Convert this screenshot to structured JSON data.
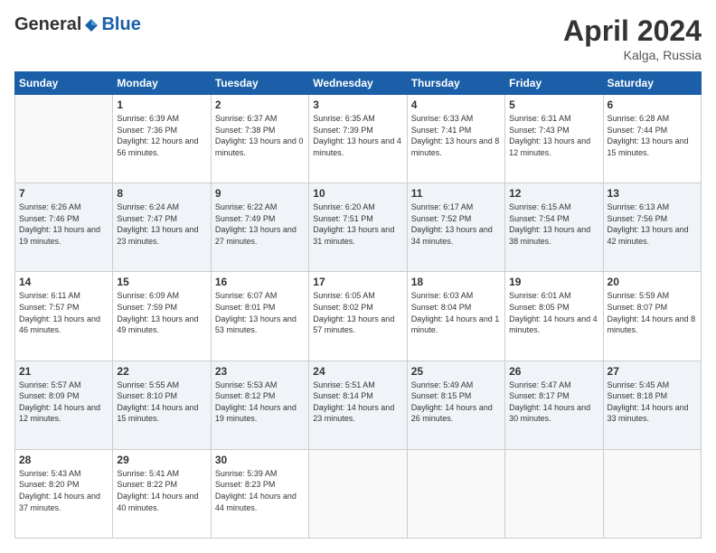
{
  "header": {
    "logo_general": "General",
    "logo_blue": "Blue",
    "month_title": "April 2024",
    "location": "Kalga, Russia"
  },
  "days_of_week": [
    "Sunday",
    "Monday",
    "Tuesday",
    "Wednesday",
    "Thursday",
    "Friday",
    "Saturday"
  ],
  "weeks": [
    [
      {
        "day": "",
        "sunrise": "",
        "sunset": "",
        "daylight": ""
      },
      {
        "day": "1",
        "sunrise": "Sunrise: 6:39 AM",
        "sunset": "Sunset: 7:36 PM",
        "daylight": "Daylight: 12 hours and 56 minutes."
      },
      {
        "day": "2",
        "sunrise": "Sunrise: 6:37 AM",
        "sunset": "Sunset: 7:38 PM",
        "daylight": "Daylight: 13 hours and 0 minutes."
      },
      {
        "day": "3",
        "sunrise": "Sunrise: 6:35 AM",
        "sunset": "Sunset: 7:39 PM",
        "daylight": "Daylight: 13 hours and 4 minutes."
      },
      {
        "day": "4",
        "sunrise": "Sunrise: 6:33 AM",
        "sunset": "Sunset: 7:41 PM",
        "daylight": "Daylight: 13 hours and 8 minutes."
      },
      {
        "day": "5",
        "sunrise": "Sunrise: 6:31 AM",
        "sunset": "Sunset: 7:43 PM",
        "daylight": "Daylight: 13 hours and 12 minutes."
      },
      {
        "day": "6",
        "sunrise": "Sunrise: 6:28 AM",
        "sunset": "Sunset: 7:44 PM",
        "daylight": "Daylight: 13 hours and 15 minutes."
      }
    ],
    [
      {
        "day": "7",
        "sunrise": "Sunrise: 6:26 AM",
        "sunset": "Sunset: 7:46 PM",
        "daylight": "Daylight: 13 hours and 19 minutes."
      },
      {
        "day": "8",
        "sunrise": "Sunrise: 6:24 AM",
        "sunset": "Sunset: 7:47 PM",
        "daylight": "Daylight: 13 hours and 23 minutes."
      },
      {
        "day": "9",
        "sunrise": "Sunrise: 6:22 AM",
        "sunset": "Sunset: 7:49 PM",
        "daylight": "Daylight: 13 hours and 27 minutes."
      },
      {
        "day": "10",
        "sunrise": "Sunrise: 6:20 AM",
        "sunset": "Sunset: 7:51 PM",
        "daylight": "Daylight: 13 hours and 31 minutes."
      },
      {
        "day": "11",
        "sunrise": "Sunrise: 6:17 AM",
        "sunset": "Sunset: 7:52 PM",
        "daylight": "Daylight: 13 hours and 34 minutes."
      },
      {
        "day": "12",
        "sunrise": "Sunrise: 6:15 AM",
        "sunset": "Sunset: 7:54 PM",
        "daylight": "Daylight: 13 hours and 38 minutes."
      },
      {
        "day": "13",
        "sunrise": "Sunrise: 6:13 AM",
        "sunset": "Sunset: 7:56 PM",
        "daylight": "Daylight: 13 hours and 42 minutes."
      }
    ],
    [
      {
        "day": "14",
        "sunrise": "Sunrise: 6:11 AM",
        "sunset": "Sunset: 7:57 PM",
        "daylight": "Daylight: 13 hours and 46 minutes."
      },
      {
        "day": "15",
        "sunrise": "Sunrise: 6:09 AM",
        "sunset": "Sunset: 7:59 PM",
        "daylight": "Daylight: 13 hours and 49 minutes."
      },
      {
        "day": "16",
        "sunrise": "Sunrise: 6:07 AM",
        "sunset": "Sunset: 8:01 PM",
        "daylight": "Daylight: 13 hours and 53 minutes."
      },
      {
        "day": "17",
        "sunrise": "Sunrise: 6:05 AM",
        "sunset": "Sunset: 8:02 PM",
        "daylight": "Daylight: 13 hours and 57 minutes."
      },
      {
        "day": "18",
        "sunrise": "Sunrise: 6:03 AM",
        "sunset": "Sunset: 8:04 PM",
        "daylight": "Daylight: 14 hours and 1 minute."
      },
      {
        "day": "19",
        "sunrise": "Sunrise: 6:01 AM",
        "sunset": "Sunset: 8:05 PM",
        "daylight": "Daylight: 14 hours and 4 minutes."
      },
      {
        "day": "20",
        "sunrise": "Sunrise: 5:59 AM",
        "sunset": "Sunset: 8:07 PM",
        "daylight": "Daylight: 14 hours and 8 minutes."
      }
    ],
    [
      {
        "day": "21",
        "sunrise": "Sunrise: 5:57 AM",
        "sunset": "Sunset: 8:09 PM",
        "daylight": "Daylight: 14 hours and 12 minutes."
      },
      {
        "day": "22",
        "sunrise": "Sunrise: 5:55 AM",
        "sunset": "Sunset: 8:10 PM",
        "daylight": "Daylight: 14 hours and 15 minutes."
      },
      {
        "day": "23",
        "sunrise": "Sunrise: 5:53 AM",
        "sunset": "Sunset: 8:12 PM",
        "daylight": "Daylight: 14 hours and 19 minutes."
      },
      {
        "day": "24",
        "sunrise": "Sunrise: 5:51 AM",
        "sunset": "Sunset: 8:14 PM",
        "daylight": "Daylight: 14 hours and 23 minutes."
      },
      {
        "day": "25",
        "sunrise": "Sunrise: 5:49 AM",
        "sunset": "Sunset: 8:15 PM",
        "daylight": "Daylight: 14 hours and 26 minutes."
      },
      {
        "day": "26",
        "sunrise": "Sunrise: 5:47 AM",
        "sunset": "Sunset: 8:17 PM",
        "daylight": "Daylight: 14 hours and 30 minutes."
      },
      {
        "day": "27",
        "sunrise": "Sunrise: 5:45 AM",
        "sunset": "Sunset: 8:18 PM",
        "daylight": "Daylight: 14 hours and 33 minutes."
      }
    ],
    [
      {
        "day": "28",
        "sunrise": "Sunrise: 5:43 AM",
        "sunset": "Sunset: 8:20 PM",
        "daylight": "Daylight: 14 hours and 37 minutes."
      },
      {
        "day": "29",
        "sunrise": "Sunrise: 5:41 AM",
        "sunset": "Sunset: 8:22 PM",
        "daylight": "Daylight: 14 hours and 40 minutes."
      },
      {
        "day": "30",
        "sunrise": "Sunrise: 5:39 AM",
        "sunset": "Sunset: 8:23 PM",
        "daylight": "Daylight: 14 hours and 44 minutes."
      },
      {
        "day": "",
        "sunrise": "",
        "sunset": "",
        "daylight": ""
      },
      {
        "day": "",
        "sunrise": "",
        "sunset": "",
        "daylight": ""
      },
      {
        "day": "",
        "sunrise": "",
        "sunset": "",
        "daylight": ""
      },
      {
        "day": "",
        "sunrise": "",
        "sunset": "",
        "daylight": ""
      }
    ]
  ]
}
